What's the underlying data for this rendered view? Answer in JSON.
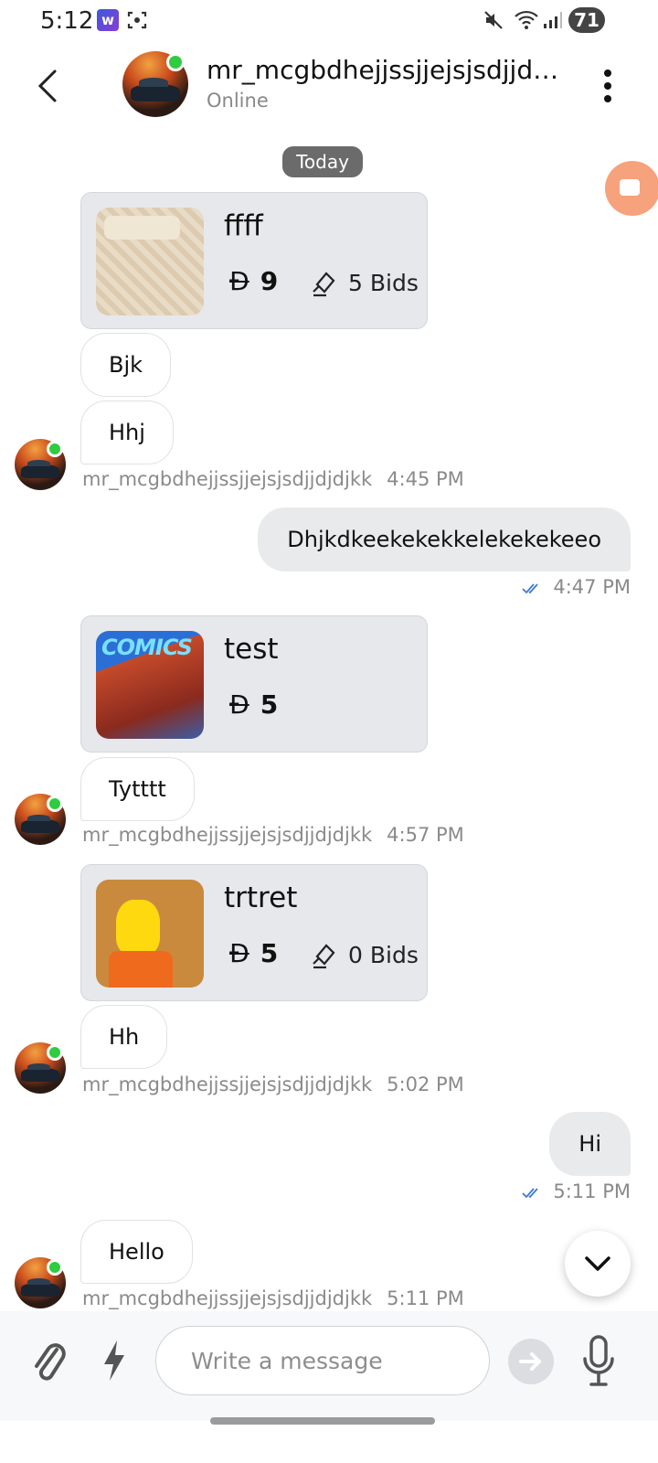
{
  "status_bar": {
    "time": "5:12",
    "app_icon_1": "w",
    "battery": "71"
  },
  "header": {
    "name": "mr_mcgbdhejjssjjejsjsdjjdj...",
    "status": "Online"
  },
  "date_chip": "Today",
  "currency_symbol": "Đ",
  "messages": {
    "product1": {
      "title": "ffff",
      "price": "9",
      "bids": "5 Bids",
      "thumb_icon": "bedsheet-image"
    },
    "m1": {
      "text": "Bjk"
    },
    "m2": {
      "text": "Hhj"
    },
    "meta1": {
      "sender": "mr_mcgbdhejjssjjejsjsdjjdjdjkk",
      "time": "4:45 PM"
    },
    "m3": {
      "text": "Dhjkdkeekekekkelekekekeeo"
    },
    "meta3": {
      "time": "4:47 PM"
    },
    "product2": {
      "title": "test",
      "price": "5",
      "thumb_icon": "comic-cover-image",
      "thumb_text": "COMICS"
    },
    "m4": {
      "text": "Tytttt"
    },
    "meta4": {
      "sender": "mr_mcgbdhejjssjjejsjsdjjdjdjkk",
      "time": "4:57 PM"
    },
    "product3": {
      "title": "trtret",
      "price": "5",
      "bids": "0 Bids",
      "thumb_icon": "cartoon-image"
    },
    "m5": {
      "text": "Hh"
    },
    "meta5": {
      "sender": "mr_mcgbdhejjssjjejsjsdjjdjdjkk",
      "time": "5:02 PM"
    },
    "m6": {
      "text": "Hi"
    },
    "meta6": {
      "time": "5:11 PM"
    },
    "m7": {
      "text": "Hello"
    },
    "meta7": {
      "sender": "mr_mcgbdhejjssjjejsjsdjjdjdjkk",
      "time": "5:11 PM"
    }
  },
  "composer": {
    "placeholder": "Write a message"
  },
  "colors": {
    "online": "#2ecc40",
    "incoming_bubble": "#ffffff",
    "outgoing_bubble": "#e9eaec",
    "card_bg": "#e6e8eb",
    "video_fab": "#f6a27c",
    "read_ticks": "#3a7bd5"
  }
}
